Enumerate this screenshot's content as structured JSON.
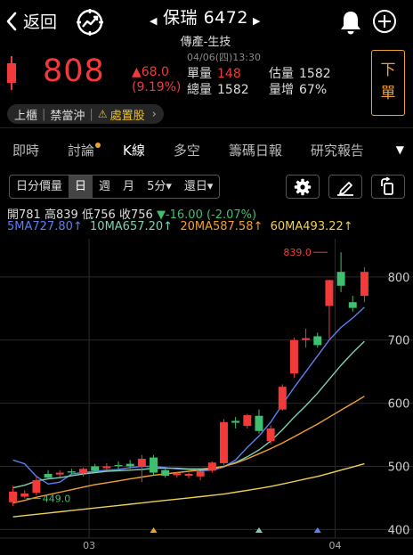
{
  "header": {
    "back_label": "返回",
    "stock_name": "保瑞 6472",
    "industry": "傳產-生技"
  },
  "quote": {
    "price": "808",
    "change": "▲68.0",
    "change_pct": "(9.19%)",
    "datetime": "04/06(四)13:30",
    "single_vol_label": "單量",
    "single_vol": "148",
    "total_vol_label": "總量",
    "total_vol": "1582",
    "est_vol_label": "估量",
    "est_vol": "1582",
    "vol_increase_label": "量增",
    "vol_increase": "67%",
    "order_button": [
      "下",
      "單"
    ],
    "tags": [
      "上櫃",
      "禁當沖",
      "處置股"
    ]
  },
  "tabs": [
    "即時",
    "討論",
    "K線",
    "多空",
    "籌碼日報",
    "研究報告"
  ],
  "toolbar": {
    "segments": [
      "日分價量",
      "日",
      "週",
      "月",
      "5分▾",
      "還日▾"
    ]
  },
  "ohlc": {
    "open_label": "開",
    "open": "781",
    "high_label": "高",
    "high": "839",
    "low_label": "低",
    "low": "756",
    "close_label": "收",
    "close": "756",
    "change": "▼-16.00 (-2.07%)"
  },
  "ma_values": [
    {
      "label": "5MA727.80↑",
      "color": "#5b7ff0"
    },
    {
      "label": "10MA657.20↑",
      "color": "#7fcfb0"
    },
    {
      "label": "20MA587.58↑",
      "color": "#f0a030"
    },
    {
      "label": "60MA493.22↑",
      "color": "#f0d050"
    }
  ],
  "colors": {
    "up": "#f23a3a",
    "down": "#3fbf6f",
    "ma5": "#5b7ff0",
    "ma10": "#7fcfb0",
    "ma20": "#f0a030",
    "ma60": "#f0d050",
    "accent": "#f0a030"
  },
  "icons": {
    "back": "chevron-left-icon",
    "logo": "stock-trend-icon",
    "bell": "bell-icon",
    "plus": "plus-circle-icon",
    "settings": "gear-icon",
    "draw": "pen-icon",
    "rotate": "rotate-icon"
  },
  "chart_data": {
    "type": "candlestick",
    "ylim": [
      392,
      852
    ],
    "y_ticks": [
      400,
      500,
      600,
      700,
      800
    ],
    "x_ticks": [
      {
        "label": "03",
        "index": 7
      },
      {
        "label": "04",
        "index": 28
      }
    ],
    "annotations": [
      {
        "label": "839.0",
        "index": 27,
        "value": 839,
        "color": "#f23a3a",
        "position": "left"
      },
      {
        "label": "449.0",
        "index": 1,
        "value": 449,
        "color": "#3fbf6f",
        "position": "right"
      }
    ],
    "candles": [
      {
        "o": 443,
        "h": 469,
        "l": 437,
        "c": 460
      },
      {
        "o": 452,
        "h": 462,
        "l": 449,
        "c": 457
      },
      {
        "o": 458,
        "h": 484,
        "l": 454,
        "c": 478
      },
      {
        "o": 488,
        "h": 494,
        "l": 480,
        "c": 482
      },
      {
        "o": 487,
        "h": 494,
        "l": 483,
        "c": 490
      },
      {
        "o": 492,
        "h": 496,
        "l": 487,
        "c": 490
      },
      {
        "o": 489,
        "h": 498,
        "l": 484,
        "c": 496
      },
      {
        "o": 500,
        "h": 504,
        "l": 491,
        "c": 493
      },
      {
        "o": 497,
        "h": 505,
        "l": 493,
        "c": 500
      },
      {
        "o": 502,
        "h": 508,
        "l": 495,
        "c": 501
      },
      {
        "o": 504,
        "h": 510,
        "l": 496,
        "c": 500
      },
      {
        "o": 500,
        "h": 518,
        "l": 475,
        "c": 512
      },
      {
        "o": 514,
        "h": 518,
        "l": 486,
        "c": 490
      },
      {
        "o": 494,
        "h": 499,
        "l": 482,
        "c": 485
      },
      {
        "o": 486,
        "h": 491,
        "l": 482,
        "c": 489
      },
      {
        "o": 485,
        "h": 490,
        "l": 481,
        "c": 488
      },
      {
        "o": 484,
        "h": 492,
        "l": 478,
        "c": 492
      },
      {
        "o": 493,
        "h": 508,
        "l": 490,
        "c": 506
      },
      {
        "o": 505,
        "h": 575,
        "l": 502,
        "c": 570
      },
      {
        "o": 572,
        "h": 578,
        "l": 560,
        "c": 569
      },
      {
        "o": 564,
        "h": 583,
        "l": 560,
        "c": 581
      },
      {
        "o": 580,
        "h": 590,
        "l": 552,
        "c": 556
      },
      {
        "o": 540,
        "h": 565,
        "l": 535,
        "c": 560
      },
      {
        "o": 590,
        "h": 630,
        "l": 588,
        "c": 626
      },
      {
        "o": 647,
        "h": 704,
        "l": 640,
        "c": 700
      },
      {
        "o": 700,
        "h": 718,
        "l": 688,
        "c": 703
      },
      {
        "o": 706,
        "h": 712,
        "l": 688,
        "c": 692
      },
      {
        "o": 754,
        "h": 796,
        "l": 702,
        "c": 795
      },
      {
        "o": 808,
        "h": 839,
        "l": 776,
        "c": 786
      },
      {
        "o": 760,
        "h": 770,
        "l": 745,
        "c": 751
      },
      {
        "o": 770,
        "h": 815,
        "l": 760,
        "c": 808
      }
    ],
    "ma": {
      "ma5": [
        510,
        504,
        484,
        472,
        475,
        488,
        490,
        492,
        494,
        495,
        498,
        500,
        500,
        498,
        496,
        495,
        493,
        494,
        499,
        510,
        530,
        548,
        570,
        598,
        625,
        650,
        675,
        700,
        720,
        735,
        752
      ],
      "ma10": [
        466,
        470,
        477,
        480,
        482,
        485,
        488,
        490,
        492,
        493,
        494,
        495,
        497,
        497,
        497,
        496,
        496,
        497,
        500,
        506,
        515,
        526,
        540,
        558,
        578,
        596,
        616,
        638,
        660,
        680,
        698
      ],
      "ma20": [
        442,
        446,
        451,
        455,
        459,
        463,
        467,
        471,
        474,
        477,
        480,
        483,
        486,
        488,
        490,
        492,
        494,
        496,
        500,
        505,
        512,
        520,
        528,
        537,
        547,
        557,
        567,
        578,
        589,
        600,
        611
      ],
      "ma60": [
        420,
        422,
        424,
        426,
        428,
        430,
        432,
        434,
        436,
        438,
        440,
        442,
        444,
        446,
        448,
        450,
        452,
        454,
        456,
        459,
        462,
        465,
        468,
        472,
        476,
        480,
        484,
        489,
        494,
        499,
        504
      ]
    },
    "markers": [
      {
        "index": 12,
        "color": "#f0a030"
      },
      {
        "index": 21,
        "color": "#7fcfb0"
      },
      {
        "index": 26,
        "color": "#5b7ff0"
      }
    ]
  }
}
